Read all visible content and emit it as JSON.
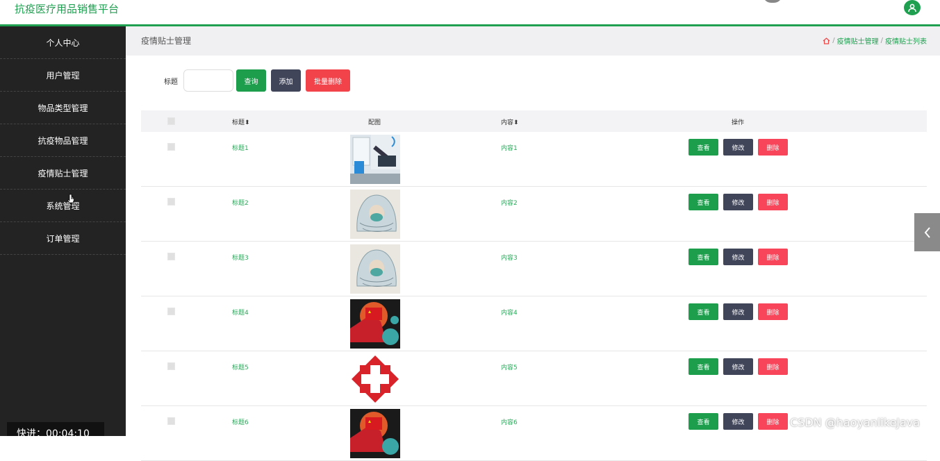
{
  "app": {
    "title": "抗疫医疗用品销售平台"
  },
  "sidebar": {
    "items": [
      {
        "label": "个人中心"
      },
      {
        "label": "用户管理"
      },
      {
        "label": "物品类型管理"
      },
      {
        "label": "抗疫物品管理"
      },
      {
        "label": "疫情贴士管理"
      },
      {
        "label": "系统管理"
      },
      {
        "label": "订单管理"
      }
    ]
  },
  "page": {
    "title": "疫情贴士管理",
    "breadcrumb": [
      "疫情贴士管理",
      "疫情贴士列表"
    ],
    "home_icon": "home-icon"
  },
  "search": {
    "label": "标题",
    "value": "",
    "query_label": "查询",
    "add_label": "添加",
    "batch_delete_label": "批量删除"
  },
  "table": {
    "headers": {
      "title": "标题",
      "image": "配图",
      "content": "内容",
      "actions": "操作"
    },
    "rows": [
      {
        "title": "标题1",
        "content": "内容1",
        "image": "doctor-at-desk"
      },
      {
        "title": "标题2",
        "content": "内容2",
        "image": "masked-worker-sketch"
      },
      {
        "title": "标题3",
        "content": "内容3",
        "image": "masked-worker-sketch"
      },
      {
        "title": "标题4",
        "content": "内容4",
        "image": "fist-flag-virus"
      },
      {
        "title": "标题5",
        "content": "内容5",
        "image": "red-cross-emblem"
      },
      {
        "title": "标题6",
        "content": "内容6",
        "image": "fist-flag-virus"
      }
    ],
    "row_actions": {
      "view": "查看",
      "edit": "修改",
      "delete": "删除"
    }
  },
  "overlay": {
    "timer": "快进：00:04:10",
    "watermark": "CSDN @haoyanlikeJava"
  },
  "colors": {
    "accent": "#1fa050",
    "sidebar": "#232323",
    "dark_button": "#41455a",
    "danger": "#f2424a"
  }
}
